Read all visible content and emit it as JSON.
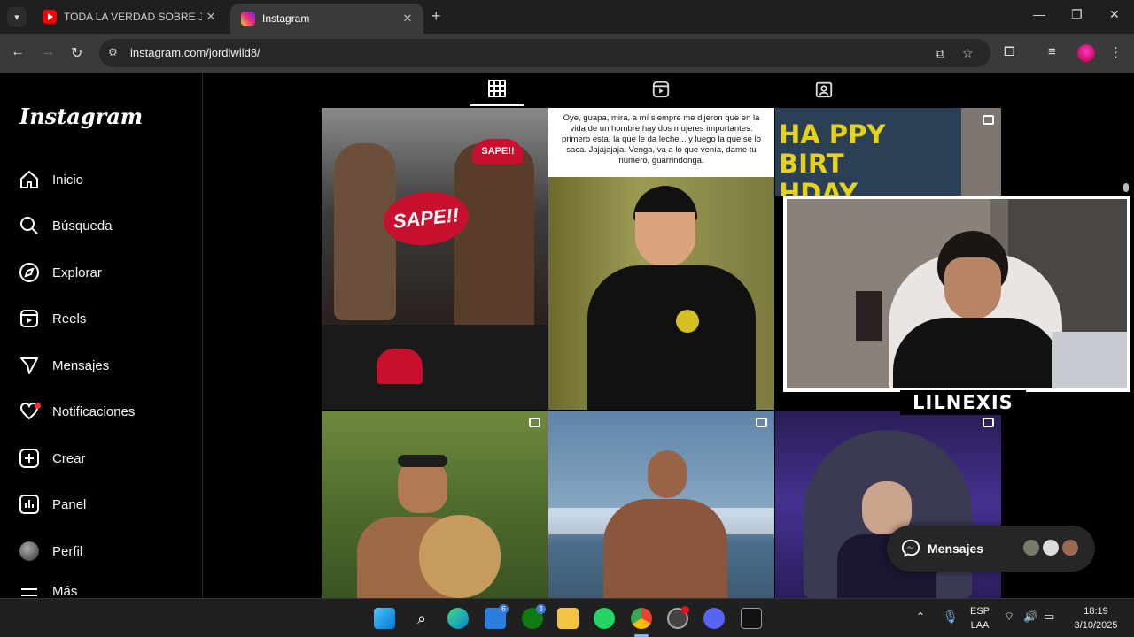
{
  "browser": {
    "tabs": [
      {
        "title": "TODA LA VERDAD SOBRE JEFFREY",
        "active": false
      },
      {
        "title": "Instagram",
        "active": true
      }
    ],
    "url": "instagram.com/jordiwild8/"
  },
  "instagram": {
    "logo": "Instagram",
    "nav": [
      {
        "label": "Inicio",
        "icon": "home-icon"
      },
      {
        "label": "Búsqueda",
        "icon": "search-icon"
      },
      {
        "label": "Explorar",
        "icon": "compass-icon"
      },
      {
        "label": "Reels",
        "icon": "reels-icon"
      },
      {
        "label": "Mensajes",
        "icon": "send-icon"
      },
      {
        "label": "Notificaciones",
        "icon": "heart-icon"
      },
      {
        "label": "Crear",
        "icon": "plus-square-icon"
      },
      {
        "label": "Panel",
        "icon": "chart-icon"
      },
      {
        "label": "Perfil",
        "icon": "avatar"
      },
      {
        "label": "Más",
        "icon": "menu-icon"
      }
    ],
    "post_caption": "Oye, guapa, mira, a mí siempre me dijeron que en la vida de un hombre hay dos mujeres importantes: primero esta, la que le da leche... y luego la que se lo saca. Jajajajaja. Venga, va a lo que venía, dame tu número, guarrindonga.",
    "birthday_text": "HA PPY BIRT HDAY",
    "cap_text": "SAPE!!",
    "messages_pill": "Mensajes"
  },
  "overlay": {
    "streamer_name": "LILNEXIS"
  },
  "taskbar": {
    "lang_top": "ESP",
    "lang_bottom": "LAA",
    "time": "18:19",
    "date": "3/10/2025",
    "store_badge": "6",
    "xbox_badge": "3"
  },
  "colors": {
    "accent": "#ff3040",
    "chrome_bg": "#1f1f1f",
    "toolbar_bg": "#3a3a3a"
  }
}
